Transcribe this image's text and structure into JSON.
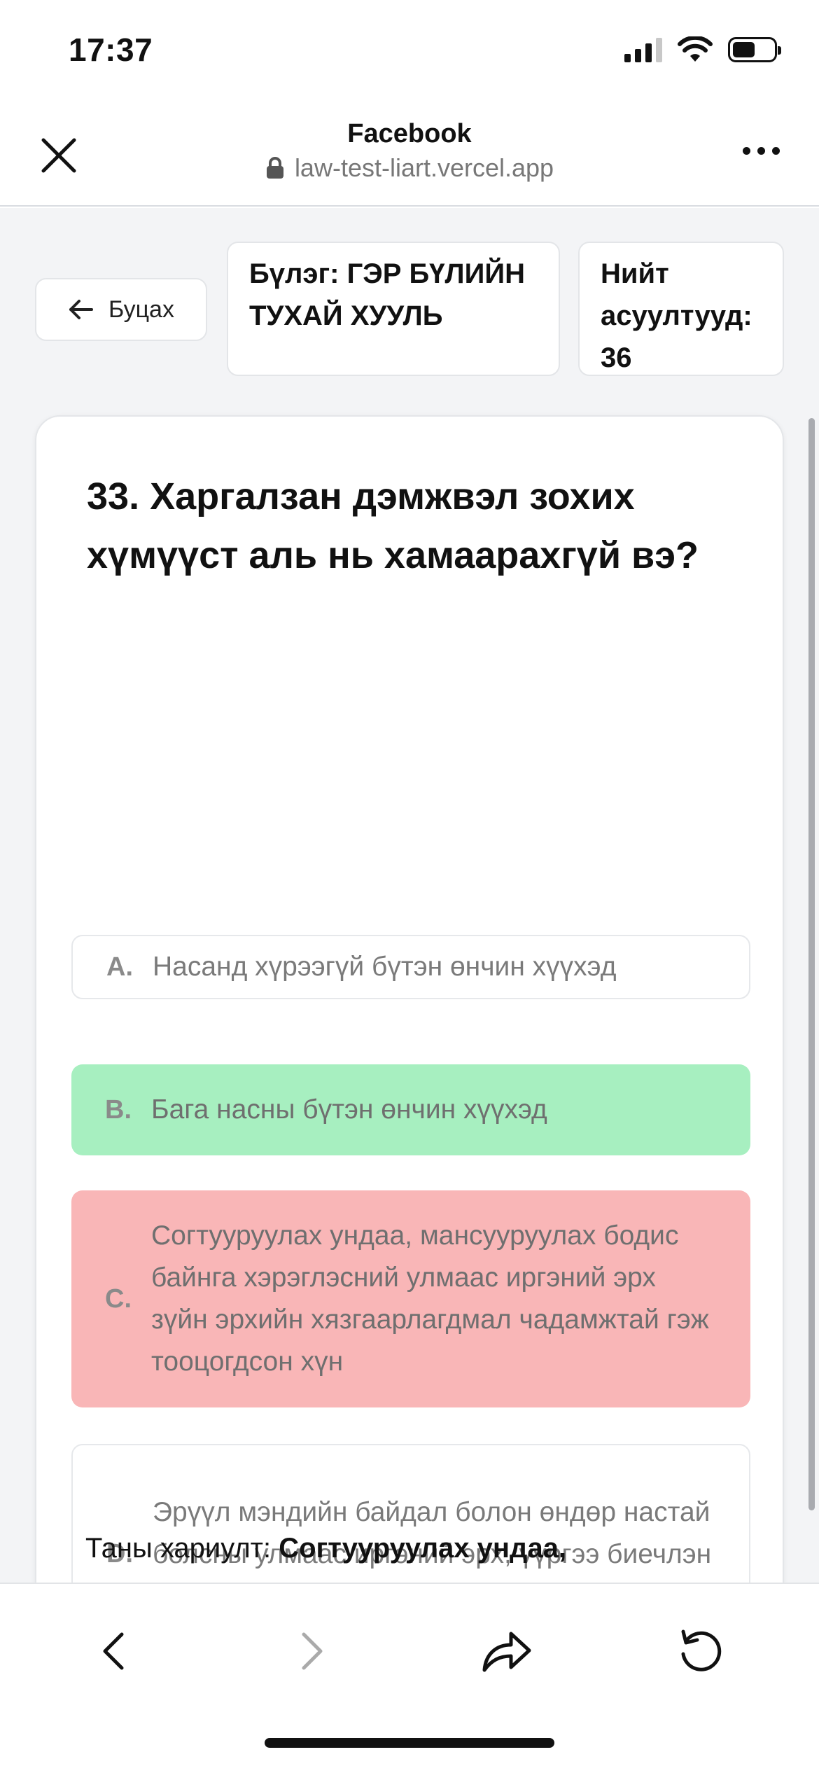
{
  "status_bar": {
    "time": "17:37"
  },
  "browser": {
    "title": "Facebook",
    "url": "law-test-liart.vercel.app"
  },
  "nav": {
    "back_label": "Буцах",
    "chapter_label": "Бүлэг: ГЭР БҮЛИЙН ТУХАЙ ХУУЛЬ",
    "total_label": "Нийт асуултууд: 36"
  },
  "question": {
    "text": "33. Харгалзан дэмжвэл зохих хүмүүст аль нь хамаарахгүй вэ?",
    "options": [
      {
        "letter": "A.",
        "text": "Насанд хүрээгүй бүтэн өнчин хүүхэд",
        "state": "neutral"
      },
      {
        "letter": "B.",
        "text": "Бага насны бүтэн өнчин хүүхэд",
        "state": "correct"
      },
      {
        "letter": "C.",
        "text": "Согтууруулах ундаа, мансууруулах бодис байнга хэрэглэсний улмаас иргэний эрх зүйн эрхийн хязгаарлагдмал чадамжтай гэж тооцогдсон хүн",
        "state": "wrong"
      },
      {
        "letter": "D.",
        "text": "Эрүүл мэндийн байдал болон өндөр настай болсны улмаас иргэний эрх, үүргээ биечлэн хэрэгжүүлэх боломжгүй болсон хүн",
        "state": "neutral"
      }
    ]
  },
  "answer": {
    "label": "Таны хариулт: ",
    "value": "Согтууруулах ундаа,"
  },
  "colors": {
    "correct": "#a7efc0",
    "wrong": "#f9b6b7",
    "page_bg": "#f3f4f6"
  }
}
